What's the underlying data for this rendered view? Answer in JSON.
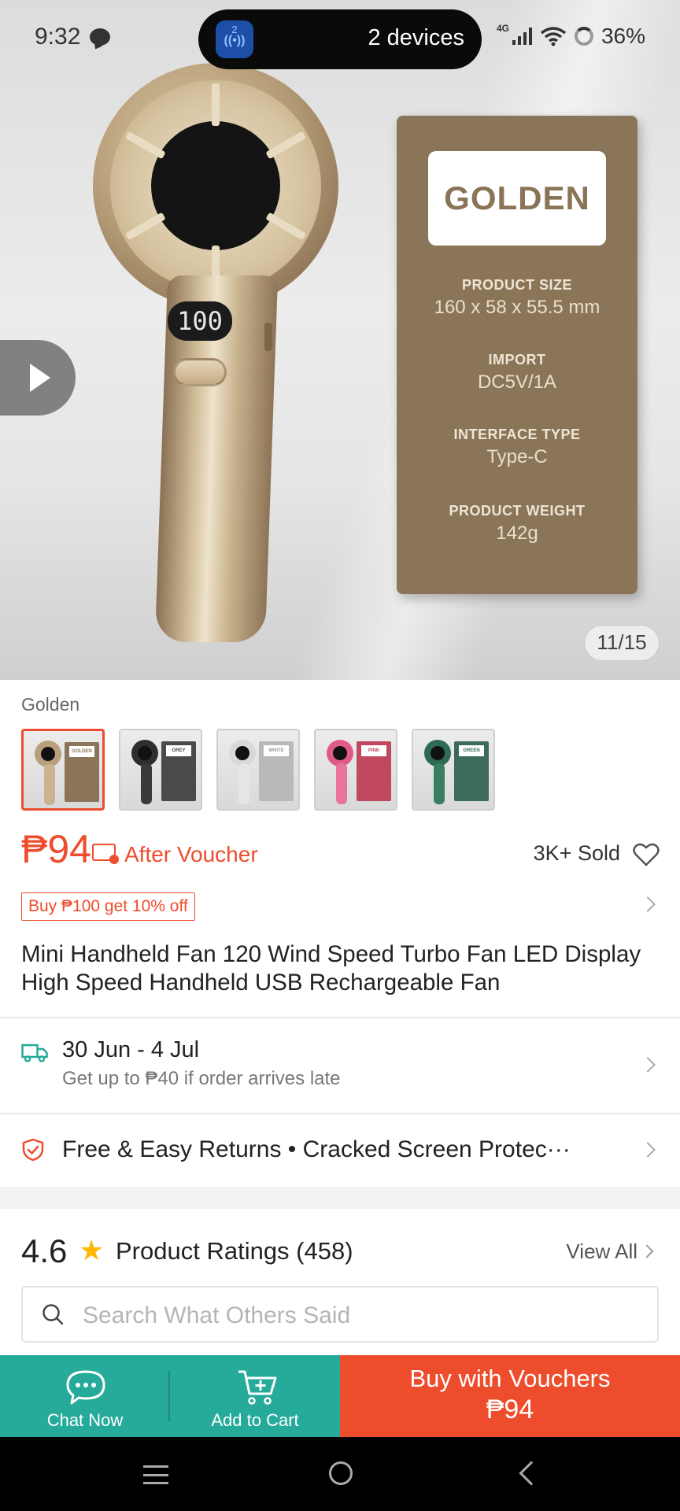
{
  "status_bar": {
    "time": "9:32",
    "pill_badge_count": "2",
    "pill_text": "2 devices",
    "network": "4G",
    "battery": "36%"
  },
  "gallery": {
    "counter": "11/15",
    "fan_display": "100",
    "spec_card": {
      "color_name": "GOLDEN",
      "specs": [
        {
          "label": "PRODUCT SIZE",
          "value": "160 x 58 x 55.5 mm"
        },
        {
          "label": "IMPORT",
          "value": "DC5V/1A"
        },
        {
          "label": "INTERFACE TYPE",
          "value": "Type-C"
        },
        {
          "label": "PRODUCT WEIGHT",
          "value": "142g"
        }
      ]
    }
  },
  "variants": {
    "selected_label": "Golden",
    "items": [
      {
        "name": "GOLDEN",
        "fan_color": "#b9a07a",
        "card_color": "#8b7558"
      },
      {
        "name": "GREY",
        "fan_color": "#2e2e2e",
        "card_color": "#4a4a4a"
      },
      {
        "name": "WHITE",
        "fan_color": "#d9d9d9",
        "card_color": "#b9b9b9"
      },
      {
        "name": "PINK",
        "fan_color": "#e05a8a",
        "card_color": "#c0485f"
      },
      {
        "name": "GREEN",
        "fan_color": "#2f6a54",
        "card_color": "#3d6b5b"
      }
    ]
  },
  "price": {
    "amount": "₱94",
    "voucher_text": "After Voucher",
    "sold": "3K+ Sold",
    "promo": "Buy ₱100 get 10% off"
  },
  "product": {
    "title": "Mini Handheld Fan 120 Wind Speed Turbo Fan  LED Display High Speed Handheld USB Rechargeable Fan"
  },
  "delivery": {
    "dates": "30 Jun - 4 Jul",
    "note": "Get up to ₱40 if order arrives late"
  },
  "guarantees": {
    "text": "Free & Easy Returns  •  Cracked Screen Protec···"
  },
  "ratings": {
    "score": "4.6",
    "label": "Product Ratings (458)",
    "view_all": "View All",
    "search_placeholder": "Search What Others Said"
  },
  "actions": {
    "chat": "Chat Now",
    "cart": "Add to Cart",
    "buy_label": "Buy with Vouchers",
    "buy_price": "₱94"
  },
  "colors": {
    "accent": "#ee4d2d",
    "teal": "#26aa99",
    "star": "#ffb800"
  }
}
